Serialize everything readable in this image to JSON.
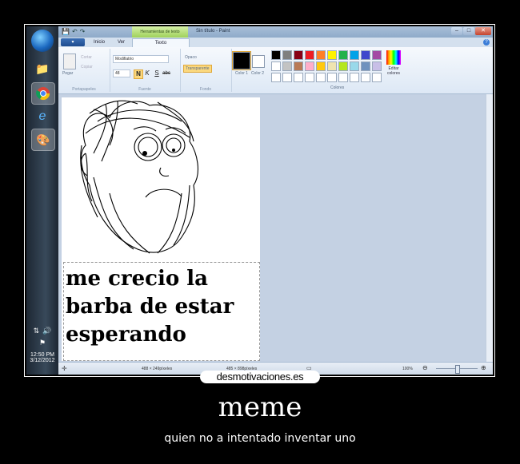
{
  "paint": {
    "title": "Sin título - Paint",
    "context_tab": "Herramientas de texto",
    "tabs": [
      "Inicio",
      "Ver",
      "Texto"
    ],
    "clipboard": {
      "paste": "Pegar",
      "cut": "Cortar",
      "copy": "Copiar",
      "label": "Portapapeles"
    },
    "font": {
      "name": "Modifiatrio",
      "size": "48",
      "label": "Fuente"
    },
    "background": {
      "opaque": "Opaco",
      "transparent": "Transparente",
      "label": "Fondo"
    },
    "colors": {
      "color1_label": "Color 1",
      "color2_label": "Color 2",
      "edit_label": "Editar colores",
      "label": "Colores",
      "color1": "#000000",
      "color2": "#ffffff",
      "palette": [
        "#000000",
        "#7f7f7f",
        "#880015",
        "#ed1c24",
        "#ff7f27",
        "#fff200",
        "#22b14c",
        "#00a2e8",
        "#3f48cc",
        "#a349a4",
        "#ffffff",
        "#c3c3c3",
        "#b97a57",
        "#ffaec9",
        "#ffc90e",
        "#efe4b0",
        "#b5e61d",
        "#99d9ea",
        "#7092be",
        "#c8bfe7",
        "#ffffff",
        "#ffffff",
        "#ffffff",
        "#ffffff",
        "#ffffff",
        "#ffffff",
        "#ffffff",
        "#ffffff",
        "#ffffff",
        "#ffffff"
      ]
    },
    "canvas_text": [
      "me crecio la",
      "barba de estar",
      "esperando"
    ],
    "status": {
      "selection": "488 × 249píxeles",
      "size": "485 × 898píxeles",
      "zoom": "100%"
    }
  },
  "taskbar": {
    "time": "12:50 PM",
    "date": "3/12/2012"
  },
  "watermark": "desmotivaciones.es",
  "poster": {
    "title": "meme",
    "subtitle": "quien no a intentado inventar uno"
  }
}
